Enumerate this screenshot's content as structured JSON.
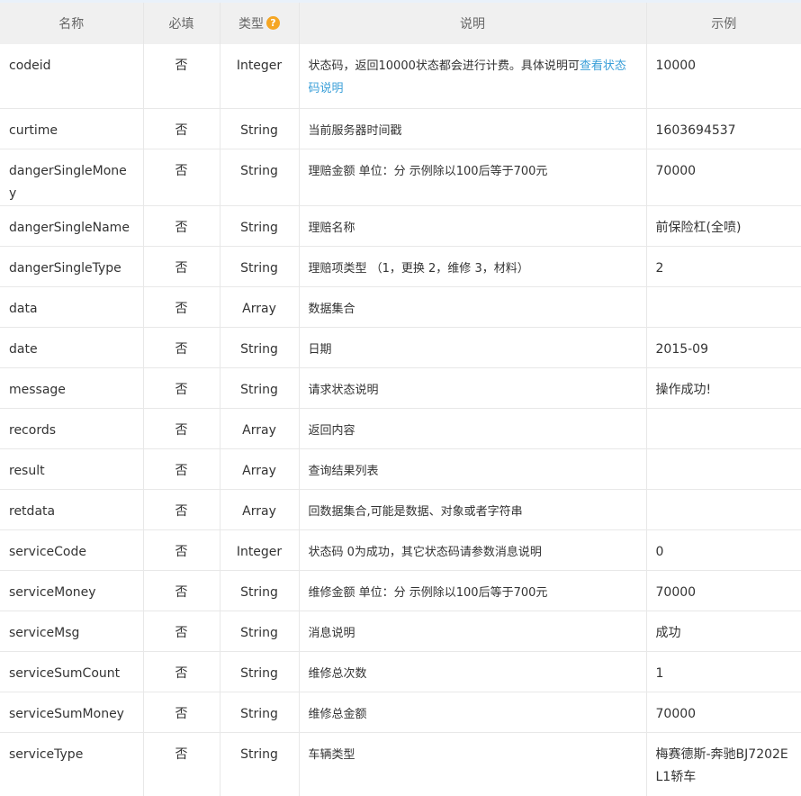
{
  "header": {
    "name": "名称",
    "required": "必填",
    "type": "类型",
    "type_help_icon": "?",
    "description": "说明",
    "example": "示例"
  },
  "rows": [
    {
      "name": "codeid",
      "required": "否",
      "type": "Integer",
      "description": "状态码，返回10000状态都会进行计费。具体说明可",
      "link": "查看状态码说明",
      "example": "10000"
    },
    {
      "name": "curtime",
      "required": "否",
      "type": "String",
      "description": "当前服务器时间戳",
      "example": "1603694537"
    },
    {
      "name": "dangerSingleMoney",
      "required": "否",
      "type": "String",
      "description": "理赔金额 单位：分 示例除以100后等于700元",
      "example": "70000"
    },
    {
      "name": "dangerSingleName",
      "required": "否",
      "type": "String",
      "description": "理赔名称",
      "example": "前保险杠(全喷)"
    },
    {
      "name": "dangerSingleType",
      "required": "否",
      "type": "String",
      "description": "理赔项类型 （1，更换 2，维修 3，材料）",
      "example": "2"
    },
    {
      "name": "data",
      "required": "否",
      "type": "Array",
      "description": "数据集合",
      "example": ""
    },
    {
      "name": "date",
      "required": "否",
      "type": "String",
      "description": "日期",
      "example": "2015-09"
    },
    {
      "name": "message",
      "required": "否",
      "type": "String",
      "description": "请求状态说明",
      "example": "操作成功!"
    },
    {
      "name": "records",
      "required": "否",
      "type": "Array",
      "description": "返回内容",
      "example": ""
    },
    {
      "name": "result",
      "required": "否",
      "type": "Array",
      "description": "查询结果列表",
      "example": ""
    },
    {
      "name": "retdata",
      "required": "否",
      "type": "Array",
      "description": "回数据集合,可能是数据、对象或者字符串",
      "example": ""
    },
    {
      "name": "serviceCode",
      "required": "否",
      "type": "Integer",
      "description": "状态码 0为成功，其它状态码请参数消息说明",
      "example": "0"
    },
    {
      "name": "serviceMoney",
      "required": "否",
      "type": "String",
      "description": "维修金额 单位：分 示例除以100后等于700元",
      "example": "70000"
    },
    {
      "name": "serviceMsg",
      "required": "否",
      "type": "String",
      "description": "消息说明",
      "example": "成功"
    },
    {
      "name": "serviceSumCount",
      "required": "否",
      "type": "String",
      "description": "维修总次数",
      "example": "1"
    },
    {
      "name": "serviceSumMoney",
      "required": "否",
      "type": "String",
      "description": "维修总金额",
      "example": "70000"
    },
    {
      "name": "serviceType",
      "required": "否",
      "type": "String",
      "description": "车辆类型",
      "example": "梅赛德斯-奔驰BJ7202EL1轿车"
    }
  ],
  "colors": {
    "header_bg": "#f0f0f0",
    "link": "#3a9fd8",
    "help_icon": "#f5a623",
    "border": "#e8e8e8"
  }
}
